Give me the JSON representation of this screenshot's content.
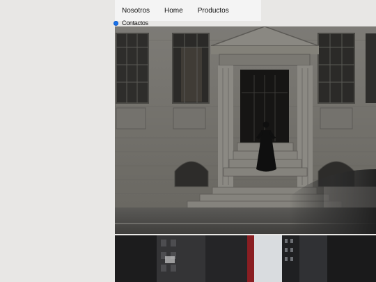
{
  "nav": {
    "items": [
      "Nosotros",
      "Home",
      "Productos"
    ]
  },
  "radio": {
    "label": "Contactos"
  },
  "photos": [
    {
      "icon": "building-photo"
    },
    {
      "icon": "city-street-photo"
    }
  ],
  "colors": {
    "page_bg": "#e8e7e5",
    "nav_bg": "#f4f4f4",
    "radio": "#1a73e8"
  }
}
